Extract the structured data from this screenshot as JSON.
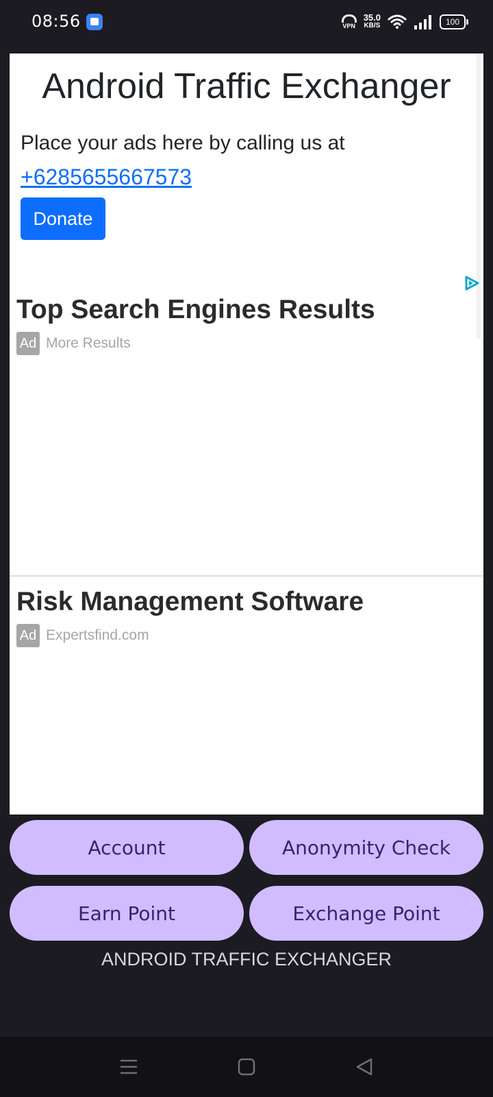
{
  "status_bar": {
    "time": "08:56",
    "vpn_label": "VPN",
    "speed_value": "35.0",
    "speed_unit": "KB/S",
    "battery": "100"
  },
  "webview": {
    "title": "Android Traffic Exchanger",
    "ad_prompt": "Place your ads here by calling us at",
    "phone": "+6285655667573",
    "donate_label": "Donate",
    "ads": [
      {
        "headline": "Top Search Engines Results",
        "badge": "Ad",
        "source": "More Results"
      },
      {
        "headline": "Risk Management Software",
        "badge": "Ad",
        "source": "Expertsfind.com"
      }
    ]
  },
  "actions": {
    "account": "Account",
    "anonymity_check": "Anonymity Check",
    "earn_point": "Earn Point",
    "exchange_point": "Exchange Point"
  },
  "footer": {
    "label": "ANDROID TRAFFIC EXCHANGER"
  },
  "colors": {
    "background": "#1c1b22",
    "pill": "#d1bcff",
    "pill_text": "#3b1f74",
    "link": "#0d6efd",
    "donate": "#0d6efd"
  },
  "icons": [
    "vpn-icon",
    "wifi-icon",
    "signal-icon",
    "battery-icon",
    "adchoices-icon",
    "menu-icon",
    "home-icon",
    "back-icon"
  ]
}
